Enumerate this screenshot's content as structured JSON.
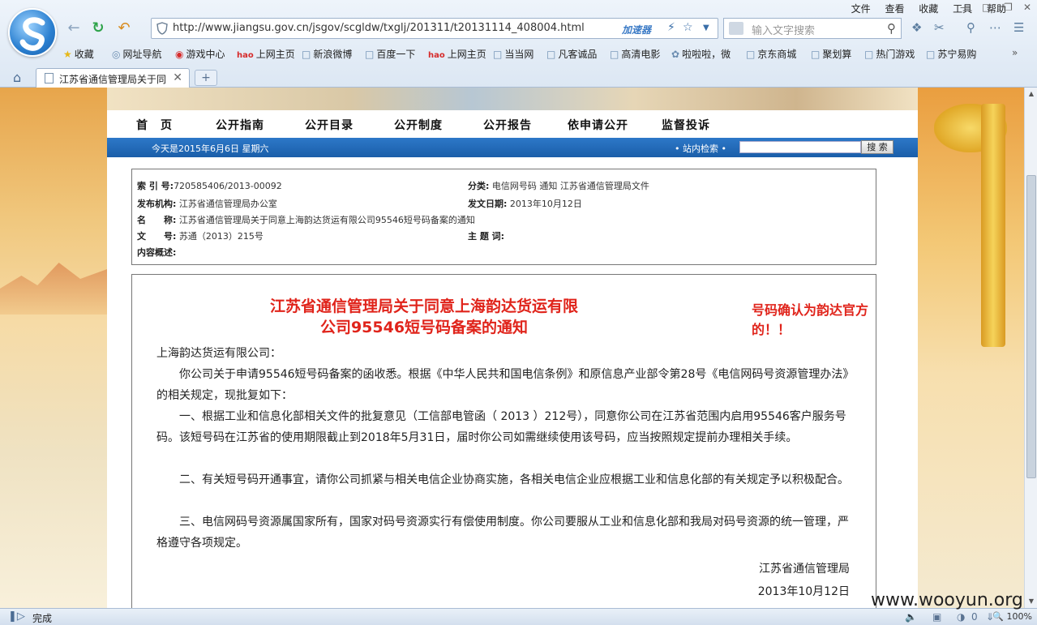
{
  "browser": {
    "menu": [
      "文件",
      "查看",
      "收藏",
      "工具",
      "帮助"
    ],
    "url": "http://www.jiangsu.gov.cn/jsgov/scgldw/txglj/201311/t20131114_408004.html",
    "accelerator": "加速器",
    "search_placeholder": "输入文字搜索",
    "favorites": [
      {
        "label": "收藏",
        "icon": "star-icon"
      },
      {
        "label": "网址导航",
        "icon": "globe-icon"
      },
      {
        "label": "游戏中心",
        "icon": "game-icon"
      },
      {
        "label": "上网主页",
        "icon": "hao-icon"
      },
      {
        "label": "新浪微博",
        "icon": "page-icon"
      },
      {
        "label": "百度一下",
        "icon": "page-icon"
      },
      {
        "label": "上网主页",
        "icon": "hao-icon"
      },
      {
        "label": "当当网",
        "icon": "page-icon"
      },
      {
        "label": "凡客诚品",
        "icon": "page-icon"
      },
      {
        "label": "高清电影",
        "icon": "page-icon"
      },
      {
        "label": "啦啦啦，微",
        "icon": "paw-icon"
      },
      {
        "label": "京东商城",
        "icon": "page-icon"
      },
      {
        "label": "聚划算",
        "icon": "page-icon"
      },
      {
        "label": "热门游戏",
        "icon": "page-icon"
      },
      {
        "label": "苏宁易购",
        "icon": "page-icon"
      }
    ],
    "tab_title": "江苏省通信管理局关于同",
    "status_text": "完成",
    "zoom": "100%",
    "status_count": "0"
  },
  "site": {
    "nav": [
      "首　页",
      "公开指南",
      "公开目录",
      "公开制度",
      "公开报告",
      "依申请公开",
      "监督投诉"
    ],
    "date_text": "今天是2015年6月6日  星期六",
    "search_label": "• 站内检索 •",
    "search_button": "搜 索"
  },
  "meta": {
    "index_key": "索 引 号:",
    "index_val": "720585406/2013-00092",
    "category_key": "分类:",
    "category_val": "电信网号码   通知   江苏省通信管理局文件",
    "issuer_key": "发布机构:",
    "issuer_val": "江苏省通信管理局办公室",
    "date_key": "发文日期:",
    "date_val": "2013年10月12日",
    "name_key": "名　　称:",
    "name_val": "江苏省通信管理局关于同意上海韵达货运有限公司95546短号码备案的通知",
    "docno_key": "文　　号:",
    "docno_val": "苏通（2013）215号",
    "subject_key": "主 题 词:",
    "summary_key": "内容概述:"
  },
  "doc": {
    "title_line1": "江苏省通信管理局关于同意上海韵达货运有限",
    "title_line2": "公司95546短号码备案的通知",
    "annotation": "号码确认为韵达官方的！！",
    "salutation": "上海韵达货运有限公司：",
    "p1": "　　你公司关于申请95546短号码备案的函收悉。根据《中华人民共和国电信条例》和原信息产业部令第28号《电信网码号资源管理办法》的相关规定，现批复如下：",
    "p2": "　　一、根据工业和信息化部相关文件的批复意见（工信部电管函（ 2013 ）212号），同意你公司在江苏省范围内启用95546客户服务号码。该短号码在江苏省的使用期限截止到2018年5月31日，届时你公司如需继续使用该号码，应当按照规定提前办理相关手续。",
    "p3": "　　二、有关短号码开通事宜，请你公司抓紧与相关电信企业协商实施，各相关电信企业应根据工业和信息化部的有关规定予以积极配合。",
    "p4": "　　三、电信网码号资源属国家所有，国家对码号资源实行有偿使用制度。你公司要服从工业和信息化部和我局对码号资源的统一管理，严格遵守各项规定。",
    "signer": "江苏省通信管理局",
    "sign_date": "2013年10月12日"
  },
  "watermark": "www.wooyun.org"
}
